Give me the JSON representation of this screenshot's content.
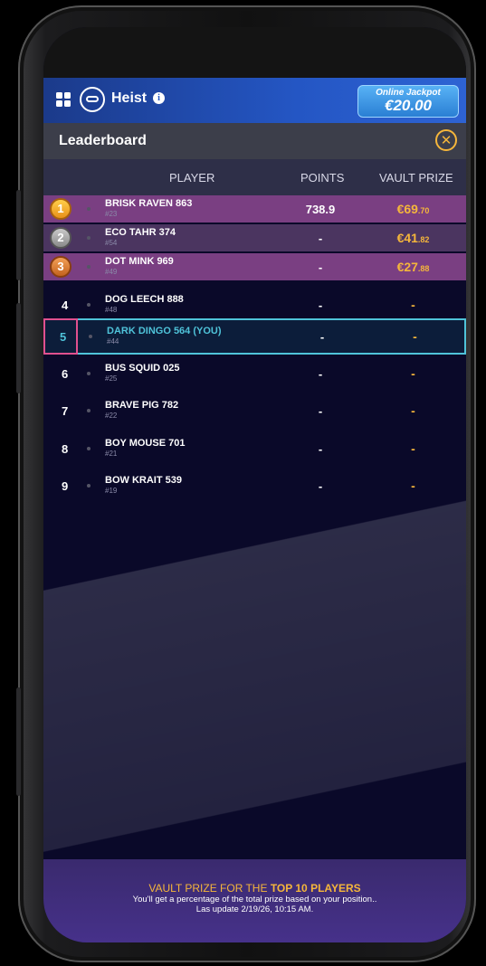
{
  "header": {
    "title": "Heist",
    "info_glyph": "i",
    "jackpot_label": "Online Jackpot",
    "jackpot_value": "€20.00"
  },
  "leaderboard": {
    "title": "Leaderboard",
    "close_glyph": "✕",
    "columns": {
      "player": "PLAYER",
      "points": "POINTS",
      "prize": "VAULT PRIZE"
    }
  },
  "rows": [
    {
      "rank": "1",
      "name": "BRISK RAVEN 863",
      "sub": "#23",
      "points": "738.9",
      "prize_main": "€69",
      "prize_cents": ".70",
      "medal": "gold"
    },
    {
      "rank": "2",
      "name": "ECO TAHR 374",
      "sub": "#54",
      "points": "-",
      "prize_main": "€41",
      "prize_cents": ".82",
      "medal": "silver"
    },
    {
      "rank": "3",
      "name": "DOT MINK 969",
      "sub": "#49",
      "points": "-",
      "prize_main": "€27",
      "prize_cents": ".88",
      "medal": "bronze"
    },
    {
      "rank": "4",
      "name": "DOG LEECH 888",
      "sub": "#48",
      "points": "-",
      "prize_main": "-",
      "prize_cents": ""
    },
    {
      "rank": "5",
      "name": "DARK DINGO 564 (YOU)",
      "sub": "#44",
      "points": "-",
      "prize_main": "-",
      "prize_cents": "",
      "you": true
    },
    {
      "rank": "6",
      "name": "BUS SQUID 025",
      "sub": "#25",
      "points": "-",
      "prize_main": "-",
      "prize_cents": ""
    },
    {
      "rank": "7",
      "name": "BRAVE PIG 782",
      "sub": "#22",
      "points": "-",
      "prize_main": "-",
      "prize_cents": ""
    },
    {
      "rank": "8",
      "name": "BOY MOUSE 701",
      "sub": "#21",
      "points": "-",
      "prize_main": "-",
      "prize_cents": ""
    },
    {
      "rank": "9",
      "name": "BOW KRAIT 539",
      "sub": "#19",
      "points": "-",
      "prize_main": "-",
      "prize_cents": ""
    }
  ],
  "footer": {
    "prefix": "VAULT PRIZE FOR THE ",
    "highlight": "TOP 10 PLAYERS",
    "line2": "You'll get a percentage of the total prize based on your position..",
    "line3": "Las update  2/19/26, 10:15 AM."
  },
  "colors": {
    "accent": "#f5b63b",
    "you_highlight": "#4fc3d9",
    "gold": "#f2a623",
    "silver": "#8c8c8c",
    "bronze": "#d9772a",
    "top_row": "#7a3f82"
  }
}
